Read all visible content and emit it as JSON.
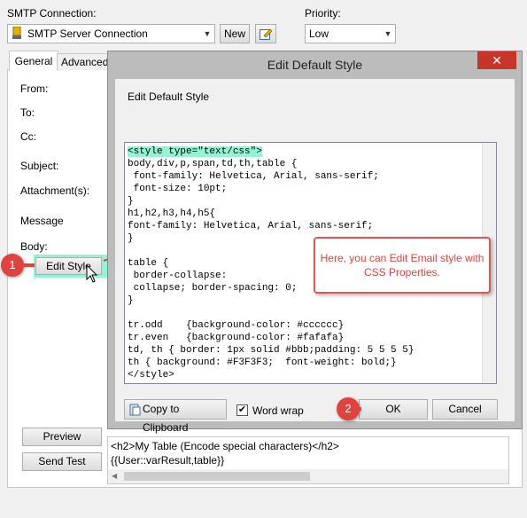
{
  "smtp": {
    "label": "SMTP Connection:",
    "value": "SMTP Server Connection",
    "new_label": "New"
  },
  "priority": {
    "label": "Priority:",
    "value": "Low"
  },
  "tabs": [
    {
      "label": "General"
    },
    {
      "label": "Advanced"
    }
  ],
  "fields": {
    "from": "From:",
    "to": "To:",
    "cc": "Cc:",
    "subject": "Subject:",
    "attachment": "Attachment(s):",
    "message": "Message",
    "body": "Body:",
    "edit_style": "Edit Style"
  },
  "buttons": {
    "preview": "Preview",
    "send_test": "Send Test"
  },
  "body_text": {
    "line1": "<h2>My Table (Encode special characters)</h2>",
    "line2": "{{User::varResult,table}}"
  },
  "dialog": {
    "title": "Edit Default Style",
    "close": "✕",
    "heading": "Edit Default Style",
    "code_first": "<style type=\"text/css\">",
    "code_rest": "body,div,p,span,td,th,table {\n font-family: Helvetica, Arial, sans-serif;\n font-size: 10pt;\n}\nh1,h2,h3,h4,h5{\nfont-family: Helvetica, Arial, sans-serif;\n}\n\ntable {\n border-collapse:\n collapse; border-spacing: 0;\n}\n\ntr.odd    {background-color: #cccccc}\ntr.even   {background-color: #fafafa}\ntd, th { border: 1px solid #bbb;padding: 5 5 5 5}\nth { background: #F3F3F3;  font-weight: bold;}\n</style>",
    "copy_label": "Copy to Clipboard",
    "wordwrap_label": "Word wrap",
    "wordwrap_checked": "✔",
    "ok_label": "OK",
    "cancel_label": "Cancel"
  },
  "callout": {
    "text": "Here, you can Edit Email style with CSS Properties."
  },
  "badges": {
    "one": "1",
    "two": "2"
  },
  "colors": {
    "accent_red": "#e0433f",
    "highlight_green": "#8ff5d2",
    "close_red": "#c7342a"
  }
}
